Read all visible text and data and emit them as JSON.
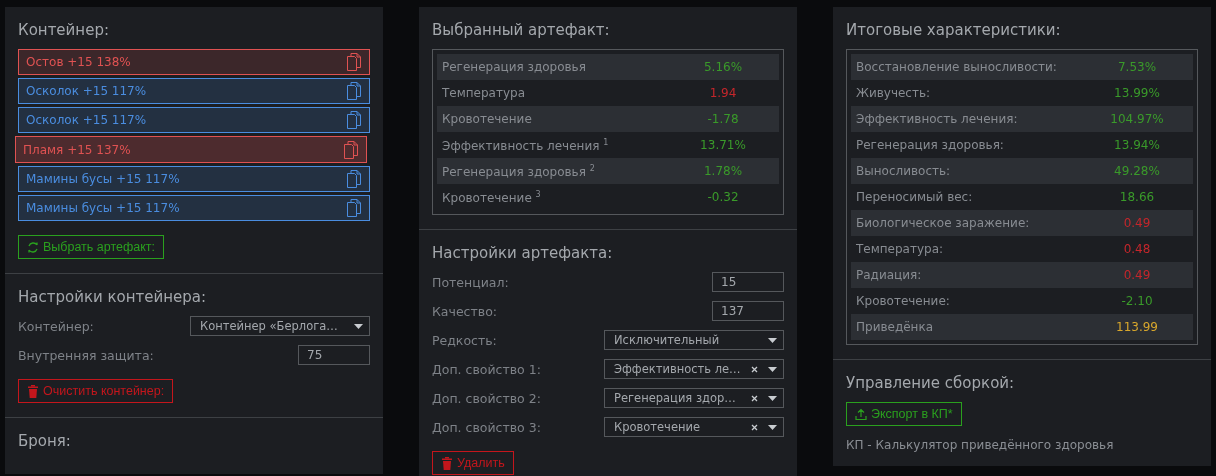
{
  "panels": [
    {
      "sections": [
        {
          "title": "Контейнер:",
          "artifacts": [
            {
              "label": "Остов +15 138%",
              "color": "#e05252",
              "selected": false
            },
            {
              "label": "Осколок +15 117%",
              "color": "#4a8de0",
              "selected": false
            },
            {
              "label": "Осколок +15 117%",
              "color": "#4a8de0",
              "selected": false
            },
            {
              "label": "Пламя +15 137%",
              "color": "#e05252",
              "selected": true
            },
            {
              "label": "Мамины бусы +15 117%",
              "color": "#4a8de0",
              "selected": false
            },
            {
              "label": "Мамины бусы +15 117%",
              "color": "#4a8de0",
              "selected": false
            }
          ],
          "button": {
            "kind": "reload",
            "label": "Выбрать артефакт:"
          }
        },
        {
          "title": "Настройки контейнера:",
          "fields": [
            {
              "kind": "select",
              "label": "Контейнер:",
              "value": "Контейнер «Берлога…",
              "clearable": false
            },
            {
              "kind": "input",
              "label": "Внутренняя защита:",
              "value": "75"
            }
          ],
          "button": {
            "kind": "delete",
            "label": "Очистить контейнер:"
          }
        },
        {
          "title": "Броня:"
        }
      ]
    },
    {
      "sections": [
        {
          "title": "Выбранный артефакт:",
          "stats": [
            {
              "label": "Регенерация здоровья",
              "value": "5.16%",
              "color": "#3a9a2a"
            },
            {
              "label": "Температура",
              "value": "1.94",
              "color": "#c4262b"
            },
            {
              "label": "Кровотечение",
              "value": "-1.78",
              "color": "#3a9a2a"
            },
            {
              "label": "Эффективность лечения $^{1}$",
              "value": "13.71%",
              "color": "#3a9a2a"
            },
            {
              "label": "Регенерация здоровья $^{2}$",
              "value": "1.78%",
              "color": "#3a9a2a"
            },
            {
              "label": "Кровотечение $^{3}$",
              "value": "-0.32",
              "color": "#3a9a2a"
            }
          ]
        },
        {
          "title": "Настройки артефакта:",
          "fields": [
            {
              "kind": "input",
              "label": "Потенциал:",
              "value": "15"
            },
            {
              "kind": "input",
              "label": "Качество:",
              "value": "137"
            },
            {
              "kind": "select",
              "label": "Редкость:",
              "value": "Исключительный",
              "clearable": false
            },
            {
              "kind": "select",
              "label": "Доп. свойство 1:",
              "value": "Эффективность ле…",
              "clearable": true
            },
            {
              "kind": "select",
              "label": "Доп. свойство 2:",
              "value": "Регенерация здор…",
              "clearable": true
            },
            {
              "kind": "select",
              "label": "Доп. свойство 3:",
              "value": "Кровотечение",
              "clearable": true
            }
          ],
          "button": {
            "kind": "delete",
            "label": "Удалить"
          }
        }
      ]
    },
    {
      "sections": [
        {
          "title": "Итоговые характеристики:",
          "stats": [
            {
              "label": "Восстановление выносливости:",
              "value": "7.53%",
              "color": "#3a9a2a"
            },
            {
              "label": "Живучесть:",
              "value": "13.99%",
              "color": "#3a9a2a"
            },
            {
              "label": "Эффективность лечения:",
              "value": "104.97%",
              "color": "#3a9a2a"
            },
            {
              "label": "Регенерация здоровья:",
              "value": "13.94%",
              "color": "#3a9a2a"
            },
            {
              "label": "Выносливость:",
              "value": "49.28%",
              "color": "#3a9a2a"
            },
            {
              "label": "Переносимый вес:",
              "value": "18.66",
              "color": "#3a9a2a"
            },
            {
              "label": "Биологическое заражение:",
              "value": "0.49",
              "color": "#c4262b"
            },
            {
              "label": "Температура:",
              "value": "0.48",
              "color": "#c4262b"
            },
            {
              "label": "Радиация:",
              "value": "0.49",
              "color": "#c4262b"
            },
            {
              "label": "Кровотечение:",
              "value": "-2.10",
              "color": "#3a9a2a"
            },
            {
              "label": "Приведёнка",
              "value": "113.99",
              "color": "#d8a72c"
            }
          ]
        },
        {
          "title": "Управление сборкой:",
          "button": {
            "kind": "export",
            "label": "Экспорт в КП*"
          },
          "note": "КП - Калькулятор приведённого здоровья"
        }
      ]
    }
  ]
}
